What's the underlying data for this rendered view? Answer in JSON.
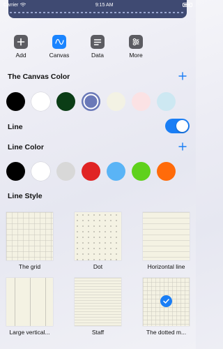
{
  "status": {
    "carrier": "Carrier",
    "time": "9:15 AM"
  },
  "toolbar": {
    "items": [
      {
        "label": "Add",
        "icon": "plus-icon",
        "active": false
      },
      {
        "label": "Canvas",
        "icon": "wave-icon",
        "active": true
      },
      {
        "label": "Data",
        "icon": "text-lines-icon",
        "active": false
      },
      {
        "label": "More",
        "icon": "sliders-icon",
        "active": false
      }
    ]
  },
  "canvas_color": {
    "title": "The Canvas Color",
    "swatches": [
      "#000000",
      "#ffffff",
      "#0b3d16",
      "#6a79b8",
      "#f3f2e4",
      "#fbe2e4",
      "#cde8f2"
    ],
    "selected_index": 3
  },
  "line": {
    "title": "Line",
    "enabled": true
  },
  "line_color": {
    "title": "Line Color",
    "swatches": [
      "#000000",
      "#ffffff",
      "#d8d8d8",
      "#e02424",
      "#5ab4f6",
      "#5fd11c",
      "#ff6b0a"
    ]
  },
  "line_style": {
    "title": "Line Style",
    "styles": [
      {
        "label": "The grid",
        "pattern": "grid"
      },
      {
        "label": "Dot",
        "pattern": "dot"
      },
      {
        "label": "Horizontal line",
        "pattern": "hline"
      },
      {
        "label": "Large vertical...",
        "pattern": "vline"
      },
      {
        "label": "Staff",
        "pattern": "staff"
      },
      {
        "label": "The dotted m...",
        "pattern": "dotted-grid"
      }
    ],
    "selected_index": 5
  },
  "colors": {
    "accent": "#1a7ef5",
    "icon_bg": "#5c5c62",
    "tile_bg": "#f4f2e3"
  }
}
